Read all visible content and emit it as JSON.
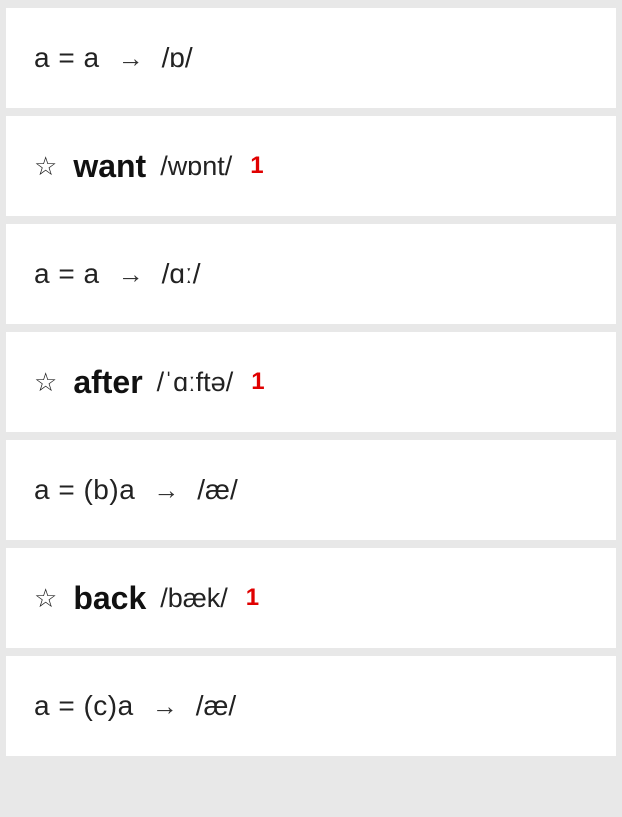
{
  "cards": [
    {
      "type": "rule",
      "lhs": "a = a",
      "arrow": "→",
      "phonetic": "/ɒ/"
    },
    {
      "type": "word",
      "star": "☆",
      "word": "want",
      "ipa": "/wɒnt/",
      "count": "1"
    },
    {
      "type": "rule",
      "lhs": "a = a",
      "arrow": "→",
      "phonetic": "/ɑː/"
    },
    {
      "type": "word",
      "star": "☆",
      "word": "after",
      "ipa": "/ˈɑːftə/",
      "count": "1"
    },
    {
      "type": "rule",
      "lhs": "a = (b)a",
      "arrow": "→",
      "phonetic": "/æ/"
    },
    {
      "type": "word",
      "star": "☆",
      "word": "back",
      "ipa": "/bæk/",
      "count": "1"
    },
    {
      "type": "rule",
      "lhs": "a = (c)a",
      "arrow": "→",
      "phonetic": "/æ/"
    }
  ]
}
